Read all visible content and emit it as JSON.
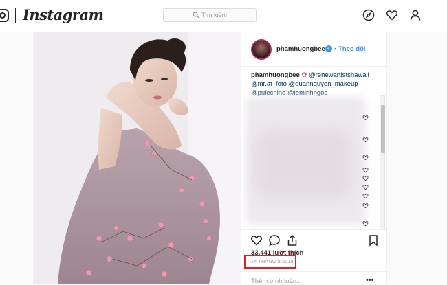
{
  "topbar": {
    "brand": "Instagram",
    "search_placeholder": "Tìm kiếm",
    "icons": [
      "camera-logo-icon",
      "search-icon",
      "compass-icon",
      "heart-icon",
      "profile-icon"
    ]
  },
  "post": {
    "username": "phamhuongbee",
    "follow_label": "Theo dõi",
    "caption_user": "phamhuongbee",
    "caption_emoji": "✿",
    "caption_mentions": "@renewartistshawaii @mr.at_foto @quannguyen_makeup @pulechino @leminhngoc",
    "likes": "33.441 lượt thích",
    "date": "14 THÁNG 9 2018",
    "add_comment_placeholder": "Thêm bình luận...",
    "more_label": "•••"
  },
  "colors": {
    "accent_blue": "#3897f0",
    "highlight_red": "#e02020",
    "border": "#dbdbdb"
  }
}
